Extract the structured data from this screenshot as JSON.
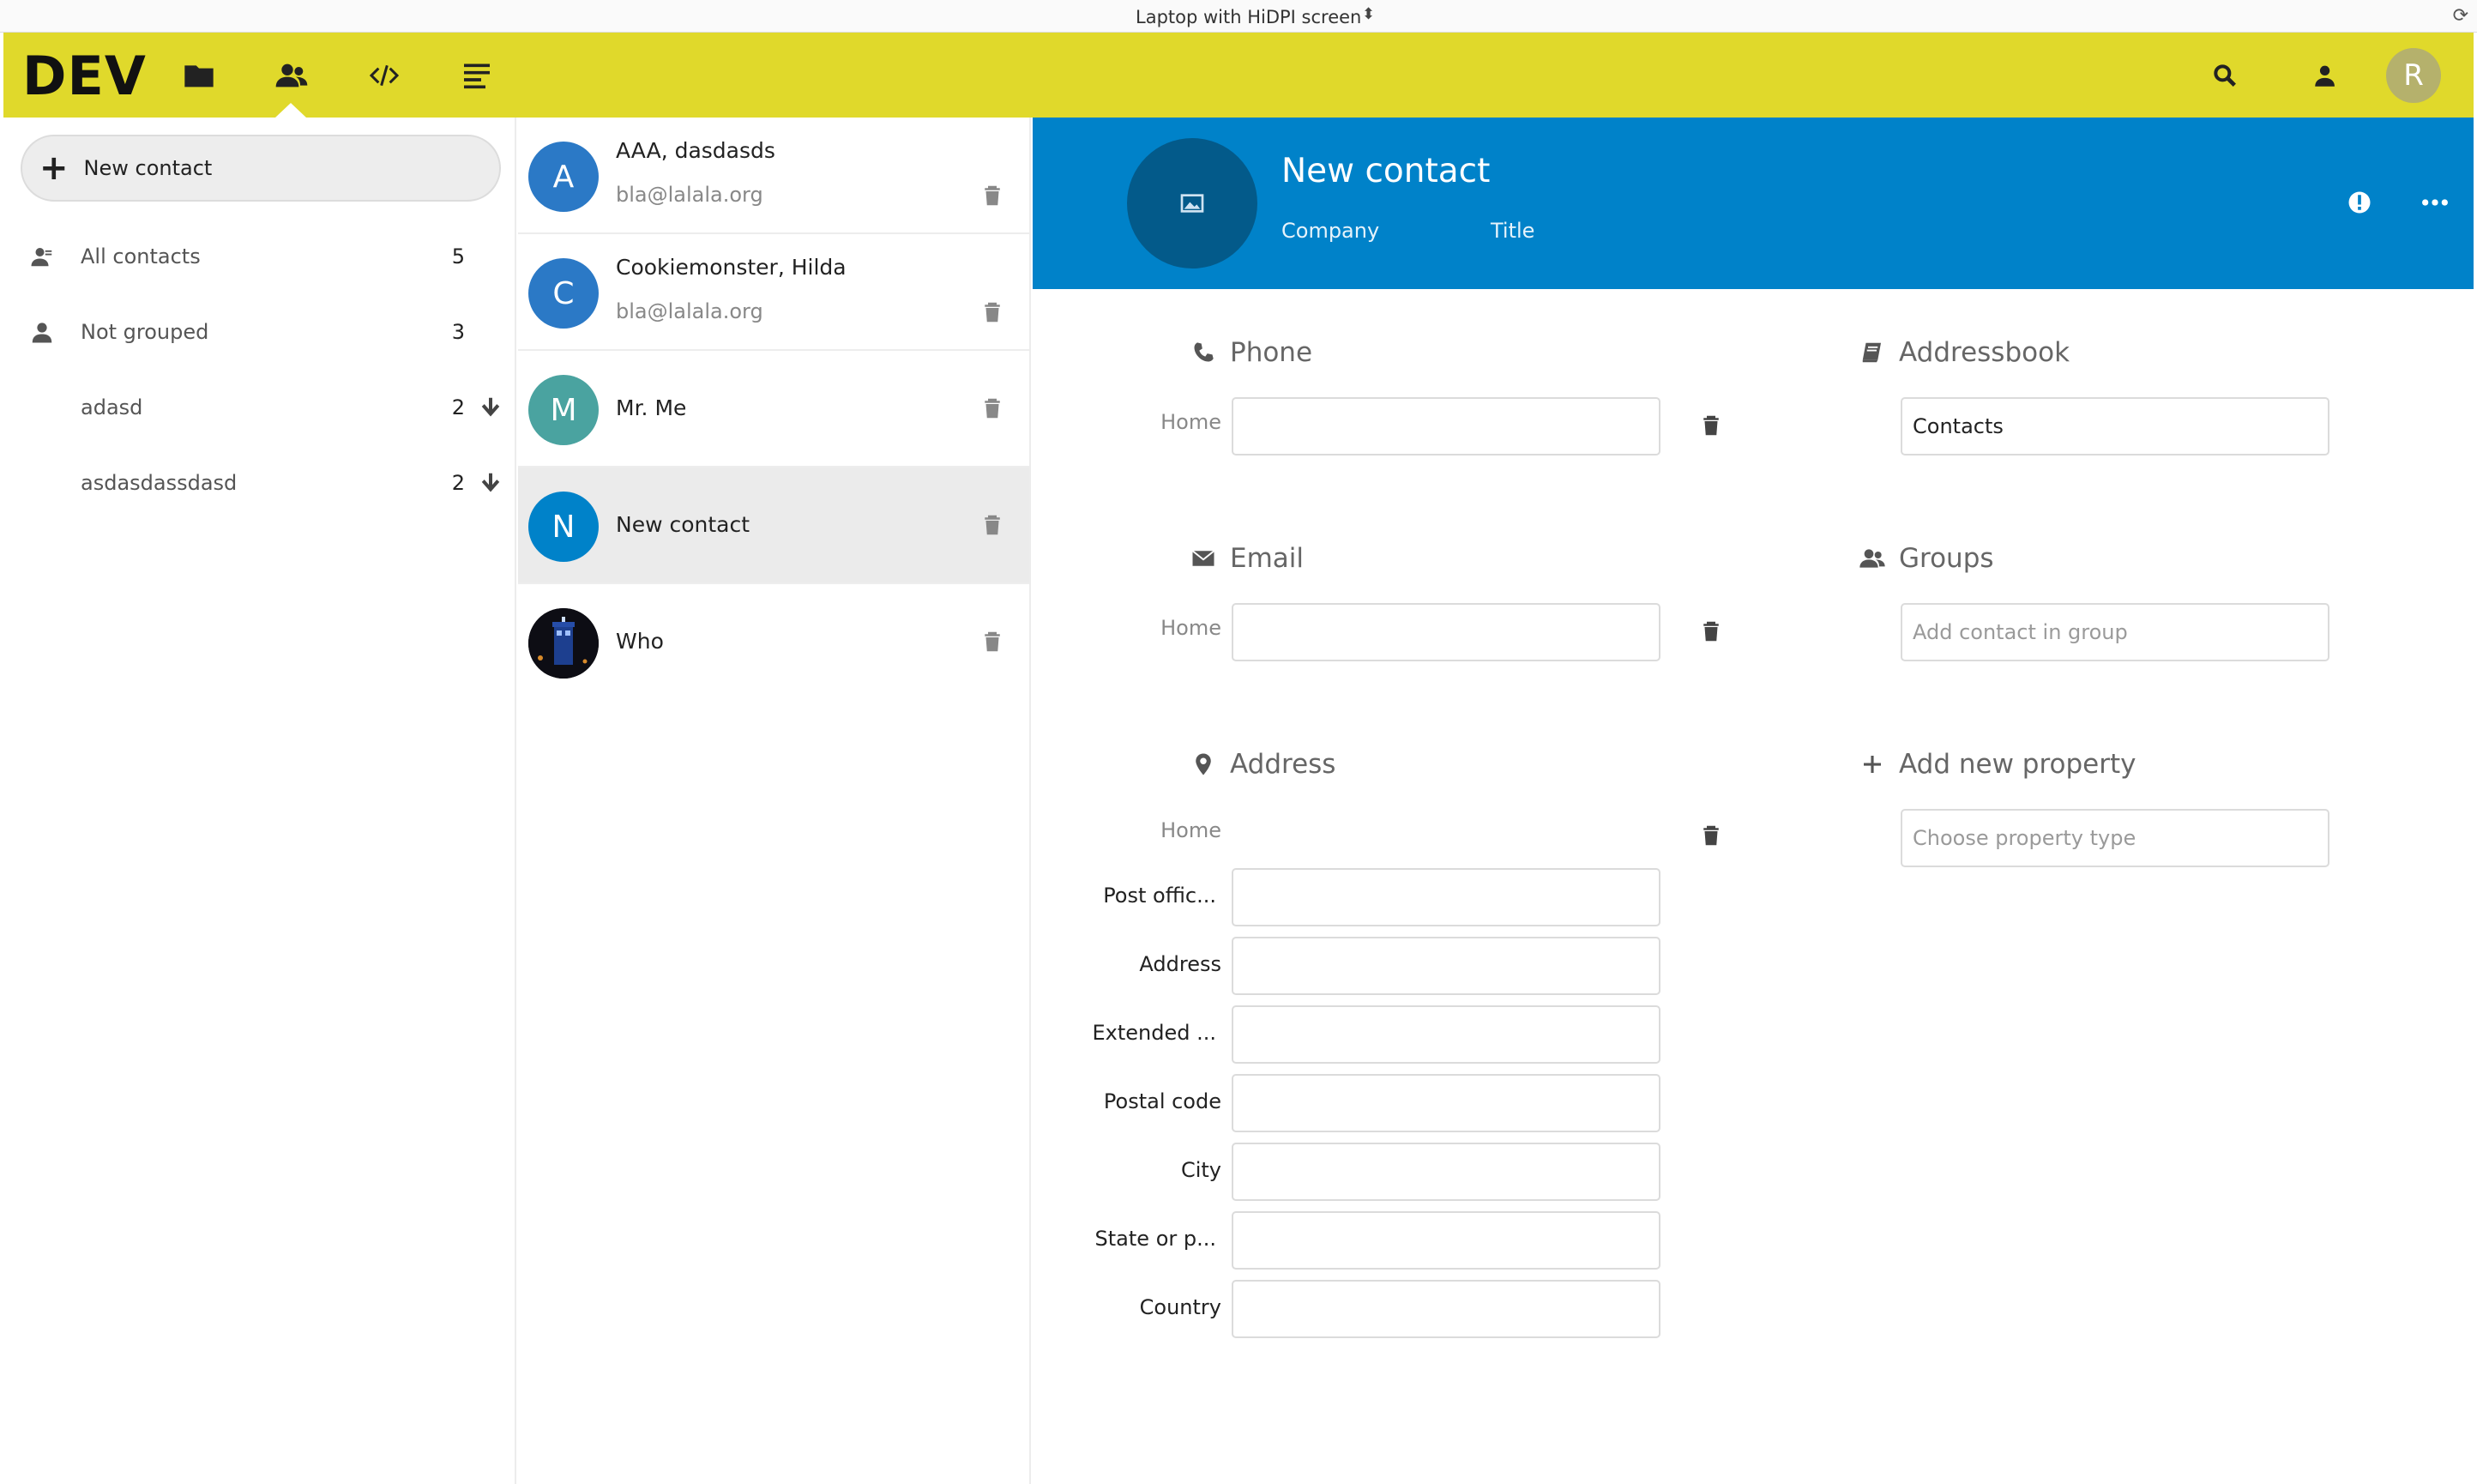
{
  "device_toolbar": {
    "label": "Laptop with HiDPI screen"
  },
  "header": {
    "logo": "DEV",
    "avatar_initial": "R",
    "brand_color": "#e0d92b"
  },
  "sidebar": {
    "new_contact_label": "New contact",
    "items": [
      {
        "label": "All contacts",
        "count": "5",
        "icon": "contacts-icon"
      },
      {
        "label": "Not grouped",
        "count": "3",
        "icon": "user-icon"
      },
      {
        "label": "adasd",
        "count": "2",
        "icon": "download-icon"
      },
      {
        "label": "asdasdassdasd",
        "count": "2",
        "icon": "download-icon"
      }
    ]
  },
  "contacts": [
    {
      "initial": "A",
      "name": "AAA, dasdasds",
      "email": "bla@lalala.org",
      "color": "#2b79c6"
    },
    {
      "initial": "C",
      "name": "Cookiemonster, Hilda",
      "email": "bla@lalala.org",
      "color": "#2b79c6"
    },
    {
      "initial": "M",
      "name": "Mr. Me",
      "email": "",
      "color": "#4aa3a0"
    },
    {
      "initial": "N",
      "name": "New contact",
      "email": "",
      "color": "#0082c9"
    },
    {
      "initial": "",
      "name": "Who",
      "email": "",
      "color": "#111111"
    }
  ],
  "detail": {
    "name": "New contact",
    "company_placeholder": "Company",
    "title_placeholder": "Title",
    "header_color": "#0082c9",
    "phone": {
      "title": "Phone",
      "type": "Home",
      "value": ""
    },
    "email": {
      "title": "Email",
      "type": "Home",
      "value": ""
    },
    "address": {
      "title": "Address",
      "type": "Home",
      "fields": [
        "Post offic...",
        "Address",
        "Extended ...",
        "Postal code",
        "City",
        "State or p...",
        "Country"
      ]
    },
    "addressbook": {
      "title": "Addressbook",
      "value": "Contacts"
    },
    "groups": {
      "title": "Groups",
      "placeholder": "Add contact in group"
    },
    "add_property": {
      "title": "Add new property",
      "placeholder": "Choose property type"
    }
  }
}
